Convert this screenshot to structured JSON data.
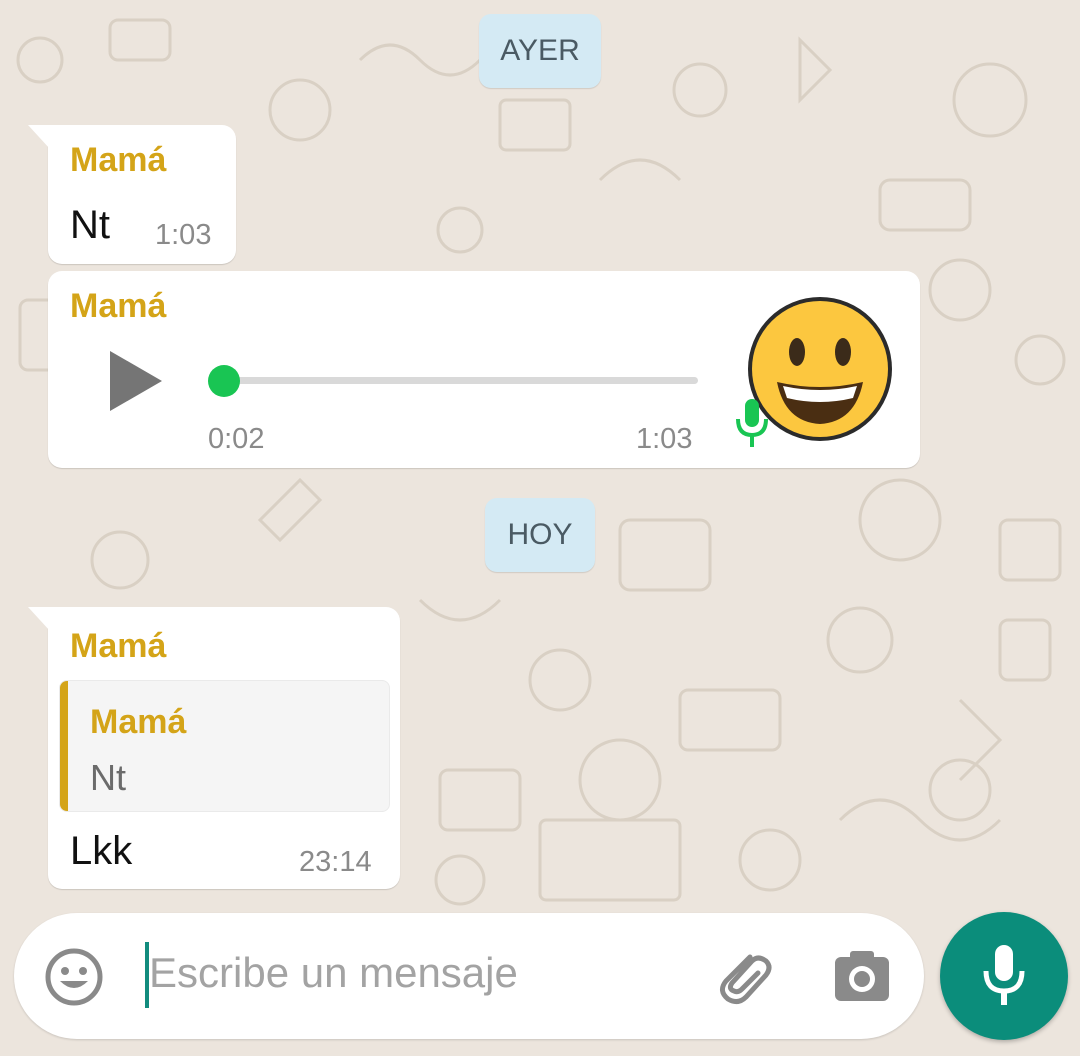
{
  "date_chips": {
    "yesterday": "AYER",
    "today": "HOY"
  },
  "messages": [
    {
      "sender": "Mamá",
      "text": "Nt",
      "time": "1:03"
    },
    {
      "sender": "Mamá",
      "audio": {
        "elapsed": "0:02",
        "time": "1:03",
        "progress": 0.0
      }
    },
    {
      "sender": "Mamá",
      "quote": {
        "sender": "Mamá",
        "text": "Nt"
      },
      "text": "Lkk",
      "time": "23:14"
    }
  ],
  "composer": {
    "placeholder": "Escribe un mensaje"
  },
  "icons": {
    "emoji": "smiley-icon",
    "attach": "paperclip-icon",
    "camera": "camera-icon",
    "send": "microphone-icon",
    "play": "play-icon",
    "avatar": "grinning-emoji-avatar"
  },
  "colors": {
    "background": "#ece5dd",
    "sender": "#d4a418",
    "accent": "#0b8d7b",
    "progress": "#19c553",
    "date_chip": "#d4eaf4"
  }
}
